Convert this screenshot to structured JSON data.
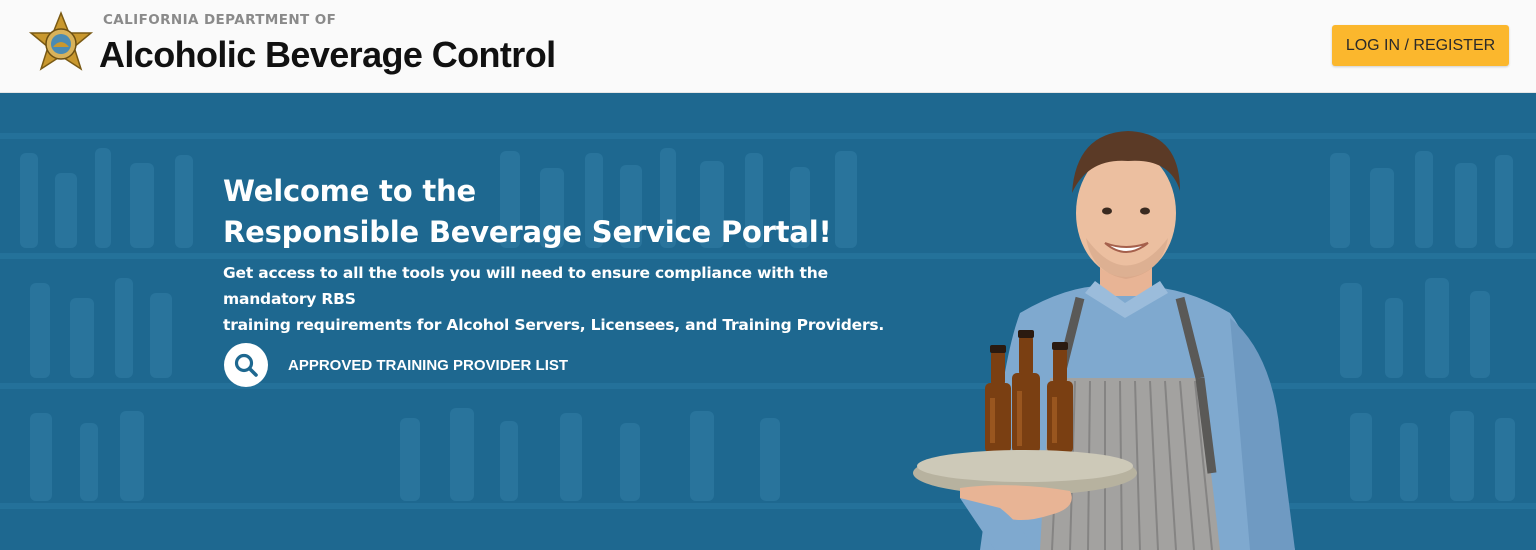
{
  "header": {
    "department": "CALIFORNIA DEPARTMENT OF",
    "agency_name": "Alcoholic Beverage Control",
    "logo_icon": "ca-abc-badge-star-icon",
    "login_label": "LOG IN / REGISTER"
  },
  "hero": {
    "title_line1": "Welcome to the",
    "title_line2": "Responsible Beverage Service Portal!",
    "subtitle_line1": "Get access to all the tools you will need to ensure compliance with the mandatory RBS",
    "subtitle_line2": "training requirements for Alcohol Servers, Licensees, and Training Providers.",
    "provider_link_label": "APPROVED TRAINING PROVIDER LIST",
    "provider_link_icon": "search-icon",
    "image": "bartender-holding-tray-of-beer-bottles"
  },
  "colors": {
    "header_bg": "#fafafa",
    "accent_button": "#fbb72d",
    "hero_bg": "#1e6890",
    "hero_text": "#ffffff"
  }
}
